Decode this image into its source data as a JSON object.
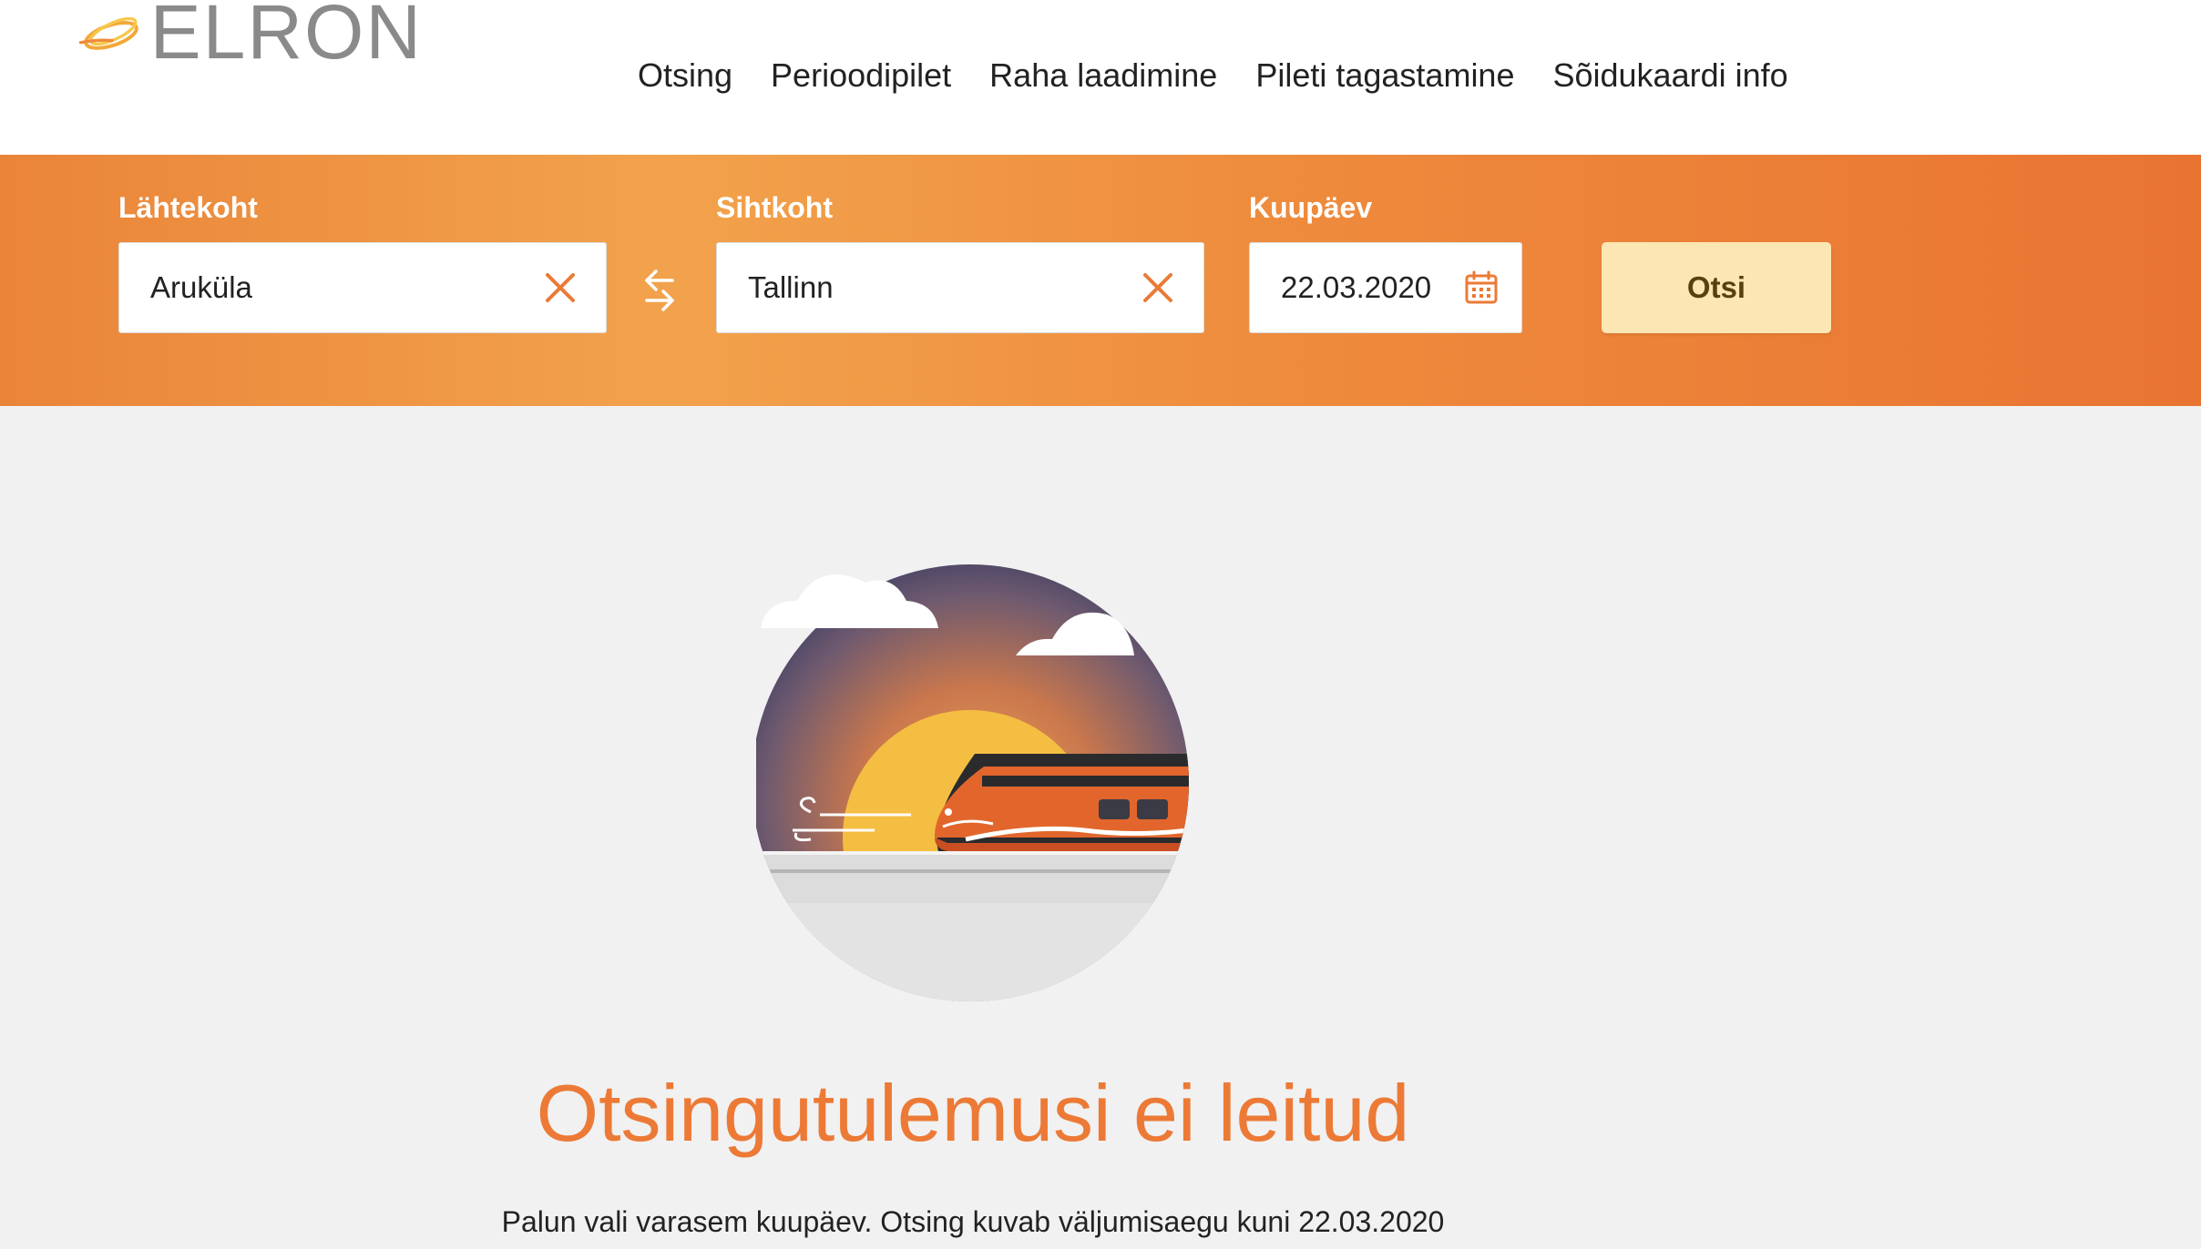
{
  "brand": {
    "name": "ELRON",
    "accent": "#ec7a36",
    "logo_color": "#8a8a8a"
  },
  "nav": {
    "items": [
      {
        "label": "Otsing"
      },
      {
        "label": "Perioodipilet"
      },
      {
        "label": "Raha laadimine"
      },
      {
        "label": "Pileti tagastamine"
      },
      {
        "label": "Sõidukaardi info"
      }
    ]
  },
  "search": {
    "from": {
      "label": "Lähtekoht",
      "value": "Aruküla",
      "clear_icon": "close-icon"
    },
    "swap_icon": "swap-arrows-icon",
    "to": {
      "label": "Sihtkoht",
      "value": "Tallinn",
      "clear_icon": "close-icon"
    },
    "date": {
      "label": "Kuupäev",
      "value": "22.03.2020",
      "icon": "calendar-icon"
    },
    "button_label": "Otsi",
    "button_color": "#fbe6b4"
  },
  "empty_state": {
    "title": "Otsingutulemusi ei leitud",
    "message": "Palun vali varasem kuupäev. Otsing kuvab väljumisaegu kuni 22.03.2020"
  }
}
